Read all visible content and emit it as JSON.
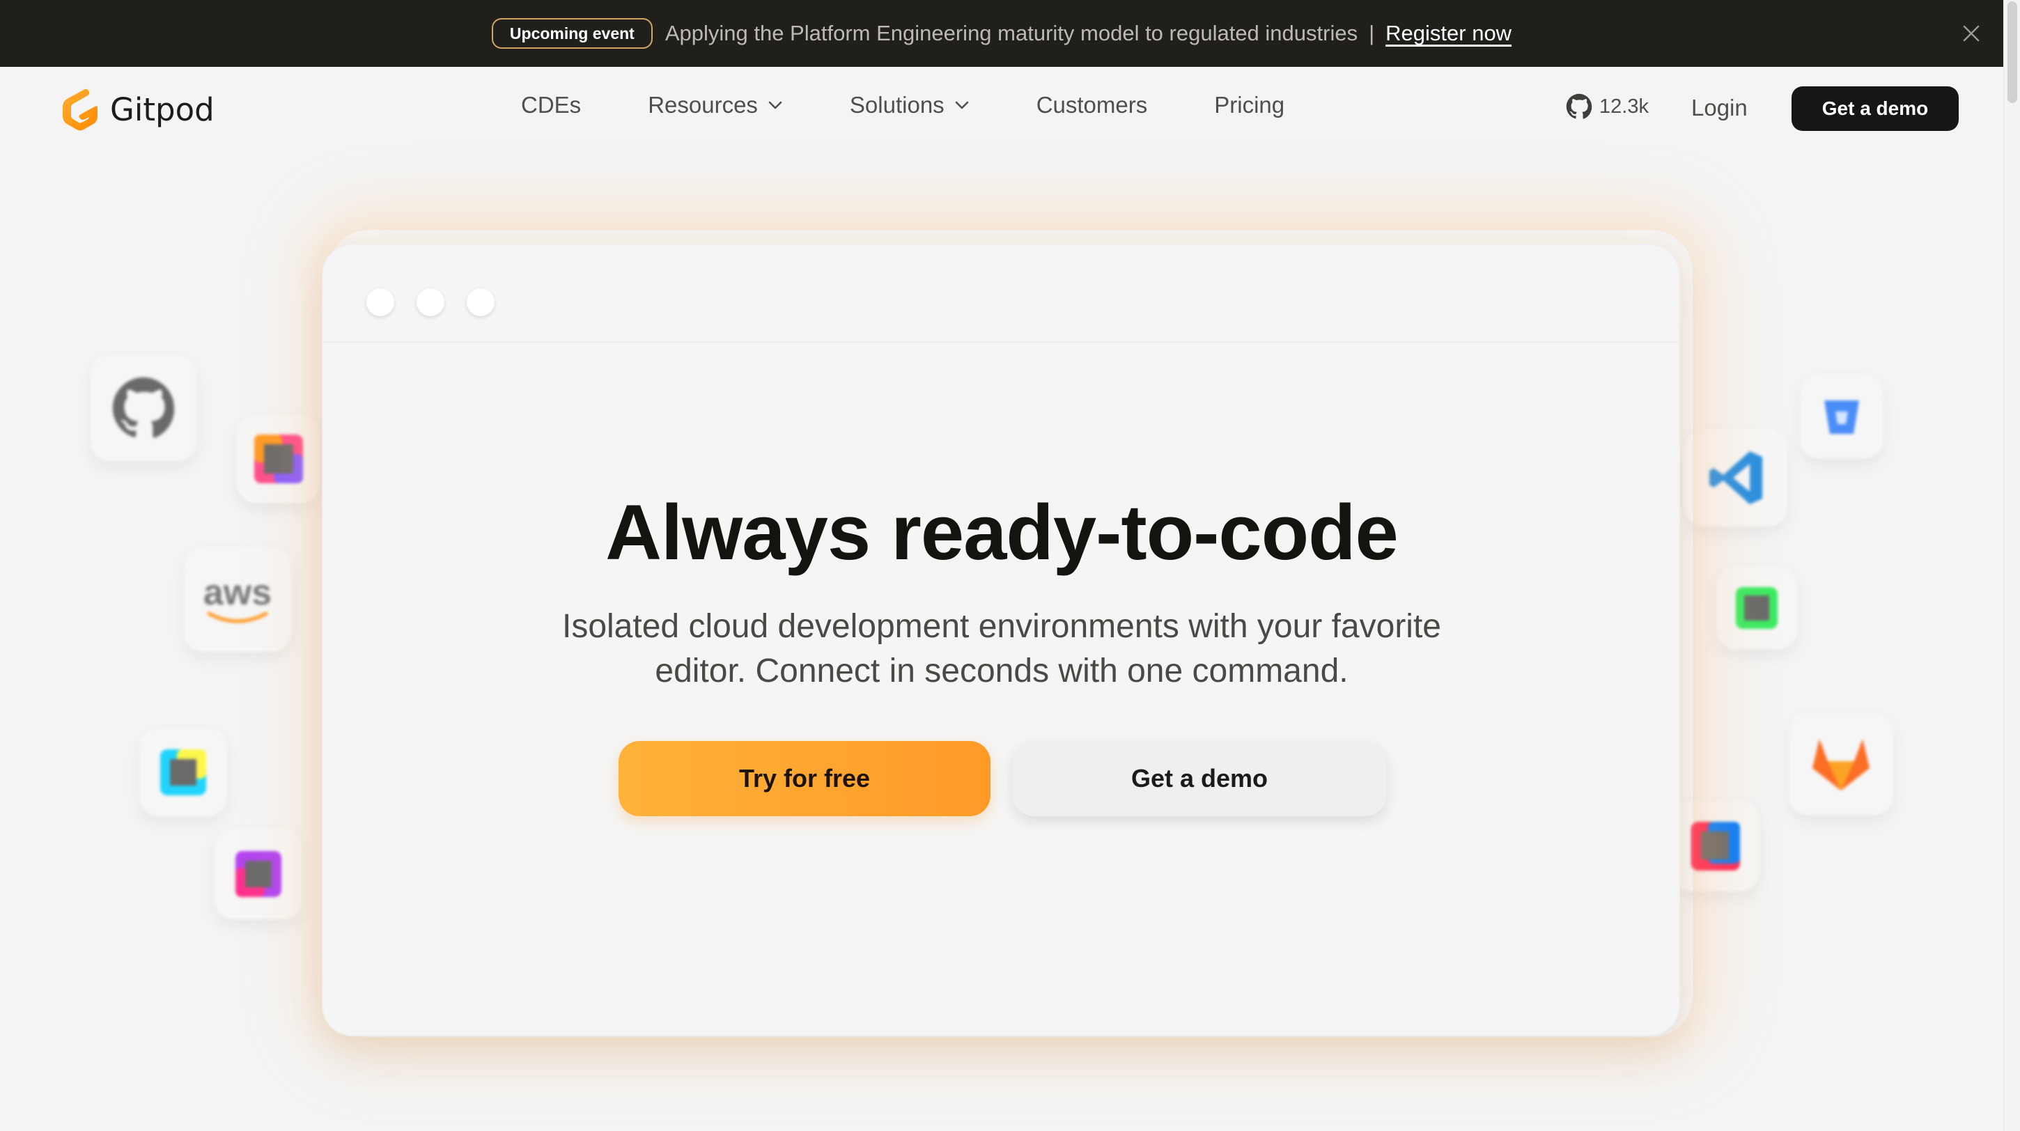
{
  "announcement": {
    "badge": "Upcoming event",
    "message": "Applying the Platform Engineering maturity model to regulated industries",
    "separator": "|",
    "cta": "Register now",
    "close_icon": "close-icon"
  },
  "nav": {
    "brand": "Gitpod",
    "links": [
      {
        "label": "CDEs",
        "has_dropdown": false
      },
      {
        "label": "Resources",
        "has_dropdown": true
      },
      {
        "label": "Solutions",
        "has_dropdown": true
      },
      {
        "label": "Customers",
        "has_dropdown": false
      },
      {
        "label": "Pricing",
        "has_dropdown": false
      }
    ],
    "github_stars": "12.3k",
    "login": "Login",
    "demo": "Get a demo"
  },
  "hero": {
    "title": "Always ready-to-code",
    "subtitle_line1": "Isolated cloud development environments with your favorite",
    "subtitle_line2": "editor. Connect in seconds with one command.",
    "primary_cta": "Try for free",
    "secondary_cta": "Get a demo"
  },
  "floating_icons": {
    "aws_text": "aws",
    "names": [
      "github-icon",
      "jetbrains-icon",
      "aws-icon",
      "webstorm-icon",
      "phpstorm-icon",
      "bitbucket-icon",
      "vscode-icon",
      "goland-icon",
      "gitlab-icon",
      "intellij-icon"
    ]
  },
  "colors": {
    "announcement_bg": "#201f1c",
    "brand_orange": "#ff9a26",
    "background": "#f4f4f4",
    "dark_button": "#161616"
  }
}
